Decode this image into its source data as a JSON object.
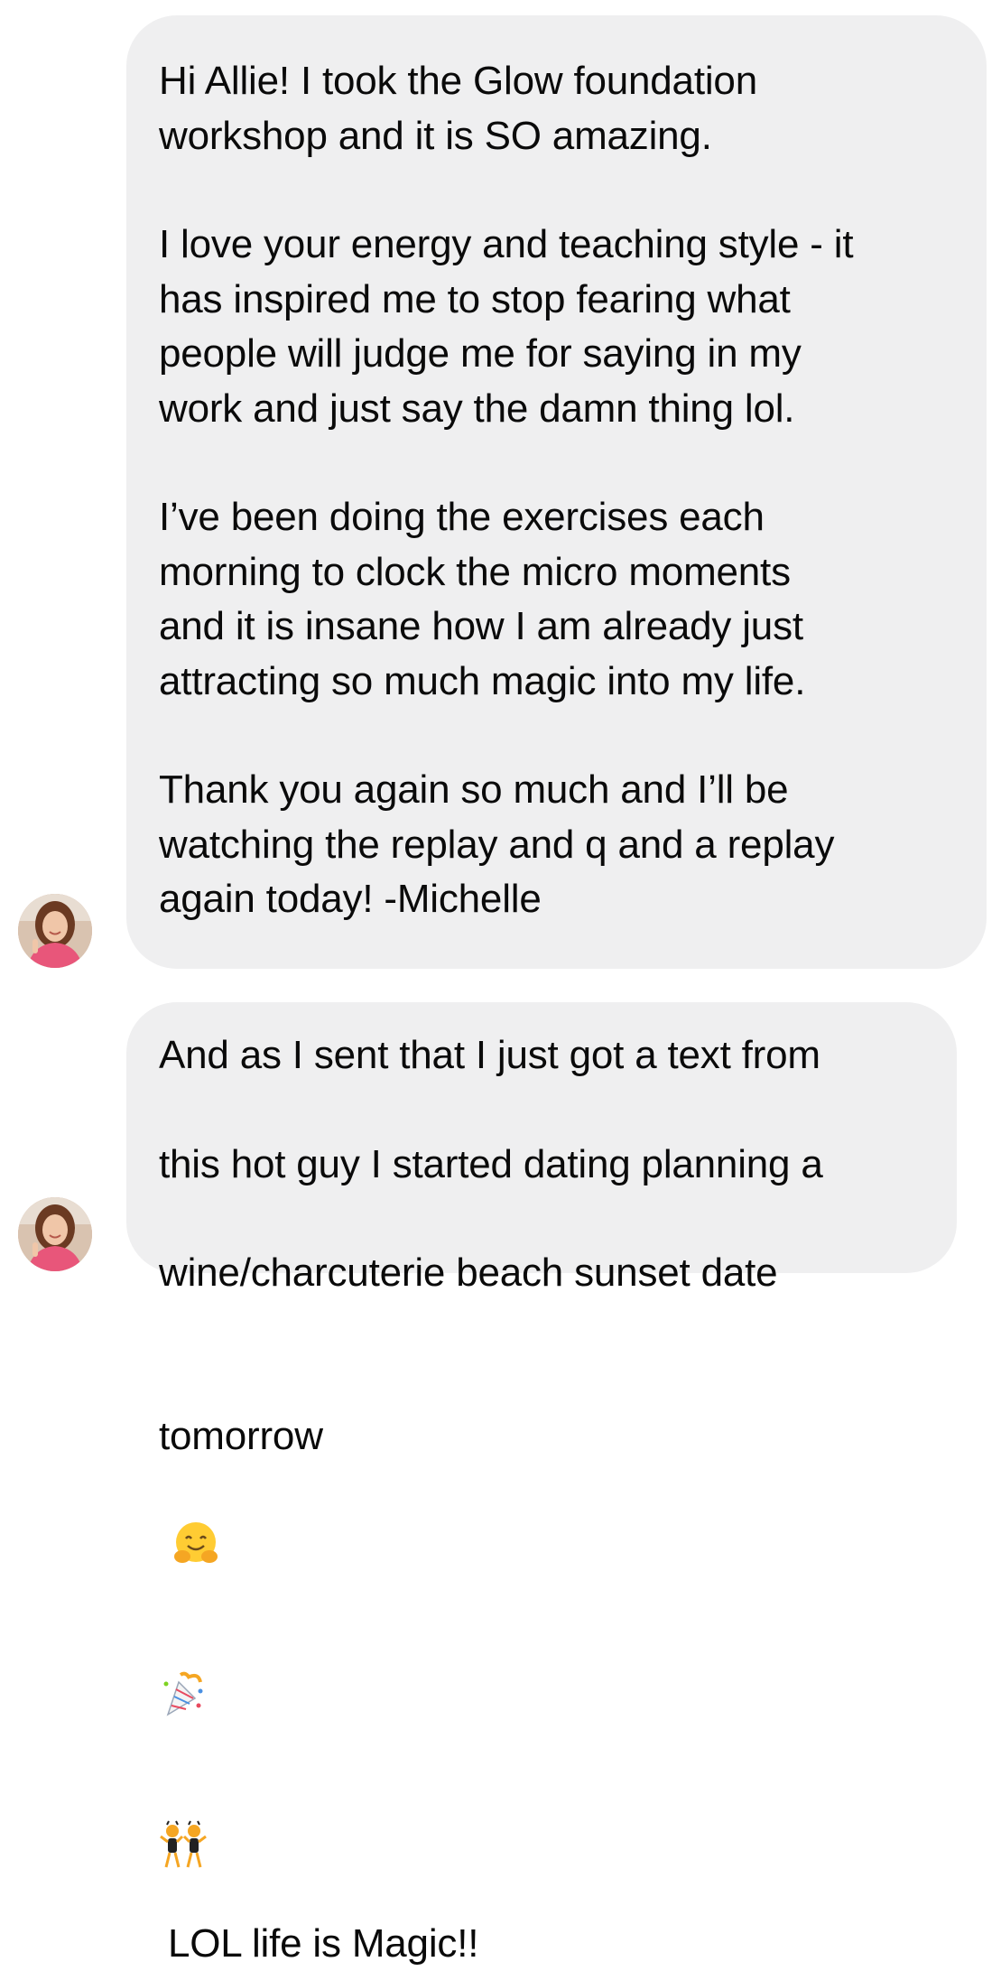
{
  "messages": [
    {
      "sender_avatar": "profile-photo",
      "paragraphs": [
        "Hi Allie! I took the Glow foundation\nworkshop and it is SO amazing.",
        "I love your energy and teaching style - it\nhas inspired me to stop fearing what\npeople will judge me for saying in my\nwork and just say the damn thing lol.",
        "I’ve been doing the exercises each\nmorning to clock the micro moments\nand it is insane how I am already just\nattracting so much magic into my life.",
        "Thank you again so much and I’ll be\nwatching the replay and q and a replay\nagain today! -Michelle"
      ]
    },
    {
      "sender_avatar": "profile-photo",
      "lines": [
        "And as I sent that I just got a text from",
        "this hot guy I started dating planning a",
        "wine/charcuterie beach sunset date"
      ],
      "last_line_start": "tomorrow",
      "emojis": [
        "hugging-face-emoji",
        "party-popper-emoji",
        "dancing-women-emoji"
      ],
      "last_line_end": "LOL life is Magic!!"
    }
  ],
  "colors": {
    "bubble": "#efeff0",
    "text": "#0a0a0a",
    "background": "#ffffff"
  }
}
